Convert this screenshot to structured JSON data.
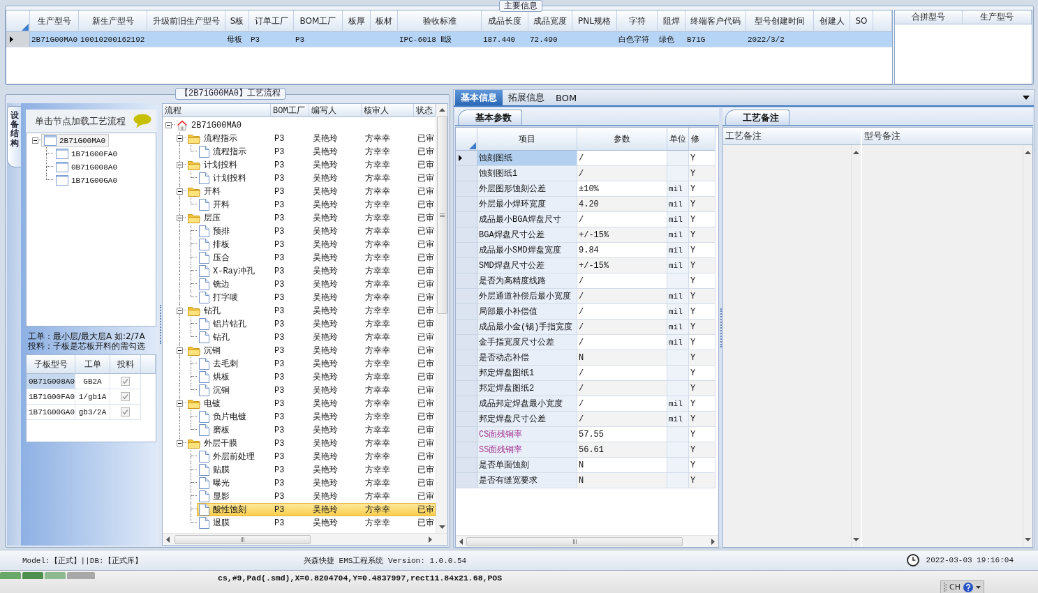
{
  "main_info": {
    "title": "主要信息",
    "columns": [
      "生产型号",
      "新生产型号",
      "升级前旧生产型号",
      "S板",
      "订单工厂",
      "BOM工厂",
      "板厚",
      "板材",
      "验收标准",
      "成品长度",
      "成品宽度",
      "PNL规格",
      "字符",
      "阻焊",
      "终端客户代码",
      "型号创建时间",
      "创建人",
      "SO"
    ],
    "rows": [
      {
        "selected": true,
        "cells": [
          "2B71G00MA0",
          "10010200162192",
          null,
          "母板",
          "P3",
          "P3",
          null,
          null,
          "IPC-6018 Ⅱ级",
          "187.440",
          "72.490",
          null,
          "白色字符",
          "绿色",
          "B71G",
          "2022/3/2",
          null,
          null
        ]
      }
    ],
    "merge_columns": [
      "合拼型号",
      "生产型号"
    ]
  },
  "process_panel": {
    "title": "【2B71G00MA0】工艺流程",
    "side_tab": "设备结构",
    "hint": "单击节点加载工艺流程",
    "structure_tree": [
      {
        "label": "2B71G00MA0",
        "expanded": true,
        "selected": true,
        "children": [
          {
            "label": "1B71G00FA0",
            "selected": false
          },
          {
            "label": "0B71G008A0",
            "selected": false
          },
          {
            "label": "1B71G00GA0",
            "selected": false
          }
        ]
      }
    ],
    "notes": [
      "工单：最小层/最大层A 如:2/7A",
      "投料：子板是芯板开料的需勾选"
    ],
    "sub_boards": {
      "columns": [
        "子板型号",
        "工单",
        "投料"
      ],
      "rows": [
        {
          "board": "0B71G008A0",
          "order": "GB2A",
          "checked": true,
          "selected": true
        },
        {
          "board": "1B71G00FA0",
          "order": "1/gb1A",
          "checked": true,
          "selected": false
        },
        {
          "board": "1B71G00GA0",
          "order": "gb3/2A",
          "checked": true,
          "selected": false
        }
      ]
    }
  },
  "flow_tree": {
    "columns": [
      "流程",
      "BOM工厂",
      "编写人",
      "核审人",
      "状态"
    ],
    "nodes": [
      {
        "label": "2B71G00MA0",
        "kind": "root",
        "expanded": true,
        "selected": false,
        "children": [
          {
            "label": "流程指示",
            "kind": "folder",
            "expanded": true,
            "selected": false,
            "bom": "P3",
            "writer": "吴艳玲",
            "reviewer": "方幸幸",
            "status": "已审",
            "children": [
              {
                "label": "流程指示",
                "kind": "step",
                "selected": false,
                "bom": "P3",
                "writer": "吴艳玲",
                "reviewer": "方幸幸",
                "status": "已审"
              }
            ]
          },
          {
            "label": "计划投料",
            "kind": "folder",
            "expanded": true,
            "selected": false,
            "bom": "P3",
            "writer": "吴艳玲",
            "reviewer": "方幸幸",
            "status": "已审",
            "children": [
              {
                "label": "计划投料",
                "kind": "step",
                "selected": false,
                "bom": "P3",
                "writer": "吴艳玲",
                "reviewer": "方幸幸",
                "status": "已审"
              }
            ]
          },
          {
            "label": "开料",
            "kind": "folder",
            "expanded": true,
            "selected": false,
            "bom": "P3",
            "writer": "吴艳玲",
            "reviewer": "方幸幸",
            "status": "已审",
            "children": [
              {
                "label": "开料",
                "kind": "step",
                "selected": false,
                "bom": "P3",
                "writer": "吴艳玲",
                "reviewer": "方幸幸",
                "status": "已审"
              }
            ]
          },
          {
            "label": "层压",
            "kind": "folder",
            "expanded": true,
            "selected": false,
            "bom": "P3",
            "writer": "吴艳玲",
            "reviewer": "方幸幸",
            "status": "已审",
            "children": [
              {
                "label": "预排",
                "kind": "step",
                "selected": false,
                "bom": "P3",
                "writer": "吴艳玲",
                "reviewer": "方幸幸",
                "status": "已审"
              },
              {
                "label": "排板",
                "kind": "step",
                "selected": false,
                "bom": "P3",
                "writer": "吴艳玲",
                "reviewer": "方幸幸",
                "status": "已审"
              },
              {
                "label": "压合",
                "kind": "step",
                "selected": false,
                "bom": "P3",
                "writer": "吴艳玲",
                "reviewer": "方幸幸",
                "status": "已审"
              },
              {
                "label": "X-Ray冲孔",
                "kind": "step",
                "selected": false,
                "bom": "P3",
                "writer": "吴艳玲",
                "reviewer": "方幸幸",
                "status": "已审"
              },
              {
                "label": "铣边",
                "kind": "step",
                "selected": false,
                "bom": "P3",
                "writer": "吴艳玲",
                "reviewer": "方幸幸",
                "status": "已审"
              },
              {
                "label": "打字唛",
                "kind": "step",
                "selected": false,
                "bom": "P3",
                "writer": "吴艳玲",
                "reviewer": "方幸幸",
                "status": "已审"
              }
            ]
          },
          {
            "label": "钻孔",
            "kind": "folder",
            "expanded": true,
            "selected": false,
            "bom": "P3",
            "writer": "吴艳玲",
            "reviewer": "方幸幸",
            "status": "已审",
            "children": [
              {
                "label": "铝片钻孔",
                "kind": "step",
                "selected": false,
                "bom": "P3",
                "writer": "吴艳玲",
                "reviewer": "方幸幸",
                "status": "已审"
              },
              {
                "label": "钻孔",
                "kind": "step",
                "selected": false,
                "bom": "P3",
                "writer": "吴艳玲",
                "reviewer": "方幸幸",
                "status": "已审"
              }
            ]
          },
          {
            "label": "沉铜",
            "kind": "folder",
            "expanded": true,
            "selected": false,
            "bom": "P3",
            "writer": "吴艳玲",
            "reviewer": "方幸幸",
            "status": "已审",
            "children": [
              {
                "label": "去毛刺",
                "kind": "step",
                "selected": false,
                "bom": "P3",
                "writer": "吴艳玲",
                "reviewer": "方幸幸",
                "status": "已审"
              },
              {
                "label": "烘板",
                "kind": "step",
                "selected": false,
                "bom": "P3",
                "writer": "吴艳玲",
                "reviewer": "方幸幸",
                "status": "已审"
              },
              {
                "label": "沉铜",
                "kind": "step",
                "selected": false,
                "bom": "P3",
                "writer": "吴艳玲",
                "reviewer": "方幸幸",
                "status": "已审"
              }
            ]
          },
          {
            "label": "电镀",
            "kind": "folder",
            "expanded": true,
            "selected": false,
            "bom": "P3",
            "writer": "吴艳玲",
            "reviewer": "方幸幸",
            "status": "已审",
            "children": [
              {
                "label": "负片电镀",
                "kind": "step",
                "selected": false,
                "bom": "P3",
                "writer": "吴艳玲",
                "reviewer": "方幸幸",
                "status": "已审"
              },
              {
                "label": "磨板",
                "kind": "step",
                "selected": false,
                "bom": "P3",
                "writer": "吴艳玲",
                "reviewer": "方幸幸",
                "status": "已审"
              }
            ]
          },
          {
            "label": "外层干膜",
            "kind": "folder",
            "expanded": true,
            "selected": false,
            "bom": "P3",
            "writer": "吴艳玲",
            "reviewer": "方幸幸",
            "status": "已审",
            "children": [
              {
                "label": "外层前处理",
                "kind": "step",
                "selected": false,
                "bom": "P3",
                "writer": "吴艳玲",
                "reviewer": "方幸幸",
                "status": "已审"
              },
              {
                "label": "贴膜",
                "kind": "step",
                "selected": false,
                "bom": "P3",
                "writer": "吴艳玲",
                "reviewer": "方幸幸",
                "status": "已审"
              },
              {
                "label": "曝光",
                "kind": "step",
                "selected": false,
                "bom": "P3",
                "writer": "吴艳玲",
                "reviewer": "方幸幸",
                "status": "已审"
              },
              {
                "label": "显影",
                "kind": "step",
                "selected": false,
                "bom": "P3",
                "writer": "吴艳玲",
                "reviewer": "方幸幸",
                "status": "已审"
              },
              {
                "label": "酸性蚀刻",
                "kind": "step",
                "selected": true,
                "bom": "P3",
                "writer": "吴艳玲",
                "reviewer": "方幸幸",
                "status": "已审"
              },
              {
                "label": "退膜",
                "kind": "step",
                "selected": false,
                "bom": "P3",
                "writer": "吴艳玲",
                "reviewer": "方幸幸",
                "status": "已审"
              }
            ]
          }
        ]
      }
    ]
  },
  "detail_tabs": [
    {
      "label": "基本信息",
      "selected": true
    },
    {
      "label": "拓展信息",
      "selected": false
    },
    {
      "label": "BOM",
      "selected": false
    }
  ],
  "basic_params": {
    "tab": "基本参数",
    "columns": [
      "项目",
      "参数",
      "单位",
      "修"
    ],
    "rows": [
      {
        "item": "蚀刻图纸",
        "value": "/",
        "modified": "Y",
        "selected": true
      },
      {
        "item": "蚀刻图纸1",
        "value": "/",
        "modified": "Y",
        "selected": false
      },
      {
        "item": "外层图形蚀刻公差",
        "value": "±10%",
        "unit": "mil",
        "modified": "Y",
        "selected": false
      },
      {
        "item": "外层最小焊环宽度",
        "value": "4.20",
        "unit": "mil",
        "modified": "Y",
        "selected": false
      },
      {
        "item": "成品最小BGA焊盘尺寸",
        "value": "/",
        "unit": "mil",
        "modified": "Y",
        "selected": false
      },
      {
        "item": "BGA焊盘尺寸公差",
        "value": "+/-15%",
        "unit": "mil",
        "modified": "Y",
        "selected": false
      },
      {
        "item": "成品最小SMD焊盘宽度",
        "value": "9.84",
        "unit": "mil",
        "modified": "Y",
        "selected": false
      },
      {
        "item": "SMD焊盘尺寸公差",
        "value": "+/-15%",
        "unit": "mil",
        "modified": "Y",
        "selected": false
      },
      {
        "item": "是否为高精度线路",
        "value": "/",
        "modified": "Y",
        "selected": false
      },
      {
        "item": "外层通道补偿后最小宽度",
        "value": "/",
        "unit": "mil",
        "modified": "Y",
        "selected": false
      },
      {
        "item": "局部最小补偿值",
        "value": "/",
        "unit": "mil",
        "modified": "Y",
        "selected": false
      },
      {
        "item": "成品最小金(锡)手指宽度",
        "value": "/",
        "unit": "mil",
        "modified": "Y",
        "selected": false
      },
      {
        "item": "金手指宽度尺寸公差",
        "value": "/",
        "unit": "mil",
        "modified": "Y",
        "selected": false
      },
      {
        "item": "是否动态补偿",
        "value": "N",
        "modified": "Y",
        "selected": false
      },
      {
        "item": "邦定焊盘图纸1",
        "value": "/",
        "modified": "Y",
        "selected": false
      },
      {
        "item": "邦定焊盘图纸2",
        "value": "/",
        "modified": "Y",
        "selected": false
      },
      {
        "item": "成品邦定焊盘最小宽度",
        "value": "/",
        "unit": "mil",
        "modified": "Y",
        "selected": false
      },
      {
        "item": "邦定焊盘尺寸公差",
        "value": "/",
        "unit": "mil",
        "modified": "Y",
        "selected": false
      },
      {
        "item": "CS面残铜率",
        "value": "57.55",
        "modified": "Y",
        "selected": false,
        "color": "#a4358f"
      },
      {
        "item": "SS面残铜率",
        "value": "56.61",
        "modified": "Y",
        "selected": false,
        "color": "#a4358f"
      },
      {
        "item": "是否单面蚀刻",
        "value": "N",
        "modified": "Y",
        "selected": false
      },
      {
        "item": "是否有缝宽要求",
        "value": "N",
        "modified": "Y",
        "selected": false
      }
    ]
  },
  "process_notes": {
    "tab": "工艺备注",
    "columns": [
      "工艺备注",
      "型号备注"
    ]
  },
  "status_bar": {
    "environment": "Model:【正式】||DB:【正式库】",
    "version": "兴森快捷 EMS工程系统 Version: 1.0.0.54",
    "datetime": "2022-03-03 19:16:04"
  },
  "background_window": {
    "status_text": "cs,#9,Pad(.smd),X=0.8204704,Y=0.4837997,rect11.84x21.68,POS",
    "language": "CH"
  }
}
